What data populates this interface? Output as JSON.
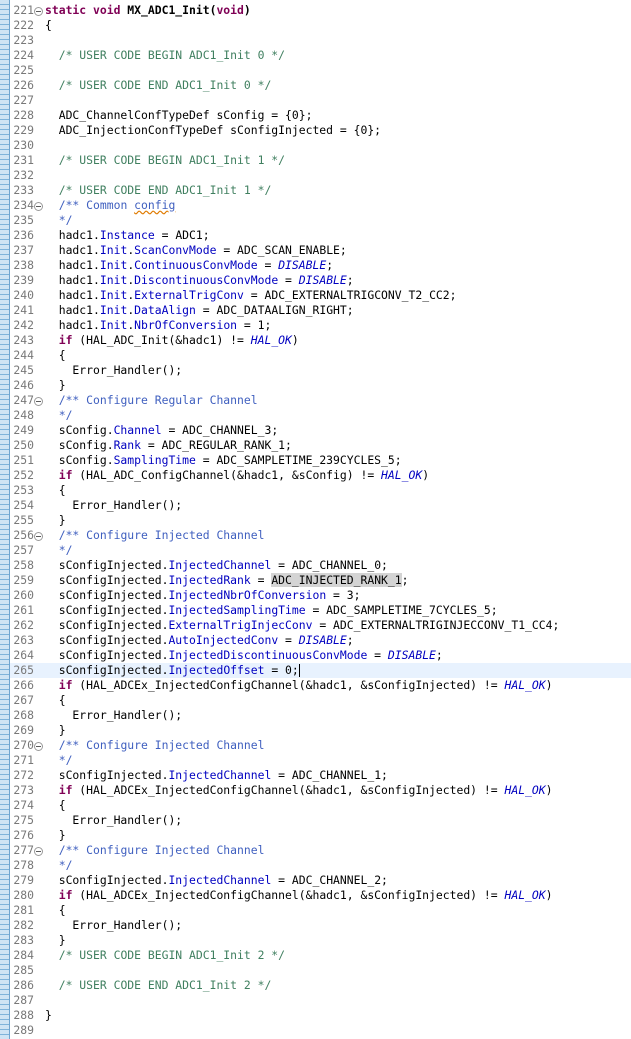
{
  "editor": {
    "language": "C",
    "current_line": "265",
    "lines": [
      {
        "n": "221",
        "fold": true,
        "t": [
          [
            "static void ",
            "kw"
          ],
          [
            "MX_ADC1_Init",
            "b"
          ],
          [
            "(",
            "b"
          ],
          [
            "void",
            "kw"
          ],
          [
            ")",
            "b"
          ]
        ]
      },
      {
        "n": "222",
        "t": [
          [
            "{",
            ""
          ]
        ]
      },
      {
        "n": "223",
        "t": []
      },
      {
        "n": "224",
        "t": [
          [
            "  ",
            ""
          ],
          [
            "/* USER CODE BEGIN ADC1_Init 0 */",
            "cm"
          ]
        ]
      },
      {
        "n": "225",
        "t": []
      },
      {
        "n": "226",
        "t": [
          [
            "  ",
            ""
          ],
          [
            "/* USER CODE END ADC1_Init 0 */",
            "cm"
          ]
        ]
      },
      {
        "n": "227",
        "t": []
      },
      {
        "n": "228",
        "t": [
          [
            "  ADC_ChannelConfTypeDef sConfig = {0};",
            ""
          ]
        ]
      },
      {
        "n": "229",
        "t": [
          [
            "  ADC_InjectionConfTypeDef sConfigInjected = {0};",
            ""
          ]
        ]
      },
      {
        "n": "230",
        "t": []
      },
      {
        "n": "231",
        "t": [
          [
            "  ",
            ""
          ],
          [
            "/* USER CODE BEGIN ADC1_Init 1 */",
            "cm"
          ]
        ]
      },
      {
        "n": "232",
        "t": []
      },
      {
        "n": "233",
        "t": [
          [
            "  ",
            ""
          ],
          [
            "/* USER CODE END ADC1_Init 1 */",
            "cm"
          ]
        ]
      },
      {
        "n": "234",
        "fold": true,
        "t": [
          [
            "  ",
            ""
          ],
          [
            "/** Common ",
            "jd"
          ],
          [
            "config",
            "jd sq"
          ]
        ]
      },
      {
        "n": "235",
        "t": [
          [
            "  ",
            ""
          ],
          [
            "*/",
            "jd"
          ]
        ]
      },
      {
        "n": "236",
        "t": [
          [
            "  hadc1.",
            ""
          ],
          [
            "Instance",
            "fld"
          ],
          [
            " = ADC1;",
            ""
          ]
        ]
      },
      {
        "n": "237",
        "t": [
          [
            "  hadc1.",
            ""
          ],
          [
            "Init",
            "fld"
          ],
          [
            ".",
            ""
          ],
          [
            "ScanConvMode",
            "fld"
          ],
          [
            " = ADC_SCAN_ENABLE;",
            ""
          ]
        ]
      },
      {
        "n": "238",
        "t": [
          [
            "  hadc1.",
            ""
          ],
          [
            "Init",
            "fld"
          ],
          [
            ".",
            ""
          ],
          [
            "ContinuousConvMode",
            "fld"
          ],
          [
            " = ",
            ""
          ],
          [
            "DISABLE",
            "mac"
          ],
          [
            ";",
            ""
          ]
        ]
      },
      {
        "n": "239",
        "t": [
          [
            "  hadc1.",
            ""
          ],
          [
            "Init",
            "fld"
          ],
          [
            ".",
            ""
          ],
          [
            "DiscontinuousConvMode",
            "fld"
          ],
          [
            " = ",
            ""
          ],
          [
            "DISABLE",
            "mac"
          ],
          [
            ";",
            ""
          ]
        ]
      },
      {
        "n": "240",
        "t": [
          [
            "  hadc1.",
            ""
          ],
          [
            "Init",
            "fld"
          ],
          [
            ".",
            ""
          ],
          [
            "ExternalTrigConv",
            "fld"
          ],
          [
            " = ADC_EXTERNALTRIGCONV_T2_CC2;",
            ""
          ]
        ]
      },
      {
        "n": "241",
        "t": [
          [
            "  hadc1.",
            ""
          ],
          [
            "Init",
            "fld"
          ],
          [
            ".",
            ""
          ],
          [
            "DataAlign",
            "fld"
          ],
          [
            " = ADC_DATAALIGN_RIGHT;",
            ""
          ]
        ]
      },
      {
        "n": "242",
        "t": [
          [
            "  hadc1.",
            ""
          ],
          [
            "Init",
            "fld"
          ],
          [
            ".",
            ""
          ],
          [
            "NbrOfConversion",
            "fld"
          ],
          [
            " = 1;",
            ""
          ]
        ]
      },
      {
        "n": "243",
        "t": [
          [
            "  ",
            ""
          ],
          [
            "if",
            "kw"
          ],
          [
            " (HAL_ADC_Init(&hadc1) != ",
            ""
          ],
          [
            "HAL_OK",
            "mac"
          ],
          [
            ")",
            ""
          ]
        ]
      },
      {
        "n": "244",
        "t": [
          [
            "  {",
            ""
          ]
        ]
      },
      {
        "n": "245",
        "t": [
          [
            "    Error_Handler();",
            ""
          ]
        ]
      },
      {
        "n": "246",
        "t": [
          [
            "  }",
            ""
          ]
        ]
      },
      {
        "n": "247",
        "fold": true,
        "t": [
          [
            "  ",
            ""
          ],
          [
            "/** Configure Regular Channel",
            "jd"
          ]
        ]
      },
      {
        "n": "248",
        "t": [
          [
            "  ",
            ""
          ],
          [
            "*/",
            "jd"
          ]
        ]
      },
      {
        "n": "249",
        "t": [
          [
            "  sConfig.",
            ""
          ],
          [
            "Channel",
            "fld"
          ],
          [
            " = ADC_CHANNEL_3;",
            ""
          ]
        ]
      },
      {
        "n": "250",
        "t": [
          [
            "  sConfig.",
            ""
          ],
          [
            "Rank",
            "fld"
          ],
          [
            " = ADC_REGULAR_RANK_1;",
            ""
          ]
        ]
      },
      {
        "n": "251",
        "t": [
          [
            "  sConfig.",
            ""
          ],
          [
            "SamplingTime",
            "fld"
          ],
          [
            " = ADC_SAMPLETIME_239CYCLES_5;",
            ""
          ]
        ]
      },
      {
        "n": "252",
        "t": [
          [
            "  ",
            ""
          ],
          [
            "if",
            "kw"
          ],
          [
            " (HAL_ADC_ConfigChannel(&hadc1, &sConfig) != ",
            ""
          ],
          [
            "HAL_OK",
            "mac"
          ],
          [
            ")",
            ""
          ]
        ]
      },
      {
        "n": "253",
        "t": [
          [
            "  {",
            ""
          ]
        ]
      },
      {
        "n": "254",
        "t": [
          [
            "    Error_Handler();",
            ""
          ]
        ]
      },
      {
        "n": "255",
        "t": [
          [
            "  }",
            ""
          ]
        ]
      },
      {
        "n": "256",
        "fold": true,
        "t": [
          [
            "  ",
            ""
          ],
          [
            "/** Configure Injected Channel",
            "jd"
          ]
        ]
      },
      {
        "n": "257",
        "t": [
          [
            "  ",
            ""
          ],
          [
            "*/",
            "jd"
          ]
        ]
      },
      {
        "n": "258",
        "t": [
          [
            "  sConfigInjected.",
            ""
          ],
          [
            "InjectedChannel",
            "fld"
          ],
          [
            " = ADC_CHANNEL_0;",
            ""
          ]
        ]
      },
      {
        "n": "259",
        "t": [
          [
            "  sConfigInjected.",
            ""
          ],
          [
            "InjectedRank",
            "fld"
          ],
          [
            " = ",
            ""
          ],
          [
            "ADC_INJECTED_RANK_1",
            "hl"
          ],
          [
            ";",
            ""
          ]
        ]
      },
      {
        "n": "260",
        "t": [
          [
            "  sConfigInjected.",
            ""
          ],
          [
            "InjectedNbrOfConversion",
            "fld"
          ],
          [
            " = 3;",
            ""
          ]
        ]
      },
      {
        "n": "261",
        "t": [
          [
            "  sConfigInjected.",
            ""
          ],
          [
            "InjectedSamplingTime",
            "fld"
          ],
          [
            " = ADC_SAMPLETIME_7CYCLES_5;",
            ""
          ]
        ]
      },
      {
        "n": "262",
        "t": [
          [
            "  sConfigInjected.",
            ""
          ],
          [
            "ExternalTrigInjecConv",
            "fld"
          ],
          [
            " = ADC_EXTERNALTRIGINJECCONV_T1_CC4;",
            ""
          ]
        ]
      },
      {
        "n": "263",
        "t": [
          [
            "  sConfigInjected.",
            ""
          ],
          [
            "AutoInjectedConv",
            "fld"
          ],
          [
            " = ",
            ""
          ],
          [
            "DISABLE",
            "mac"
          ],
          [
            ";",
            ""
          ]
        ]
      },
      {
        "n": "264",
        "t": [
          [
            "  sConfigInjected.",
            ""
          ],
          [
            "InjectedDiscontinuousConvMode",
            "fld"
          ],
          [
            " = ",
            ""
          ],
          [
            "DISABLE",
            "mac"
          ],
          [
            ";",
            ""
          ]
        ]
      },
      {
        "n": "265",
        "caret": true,
        "t": [
          [
            "  sConfigInjected.",
            ""
          ],
          [
            "InjectedOffset",
            "fld"
          ],
          [
            " = 0;",
            ""
          ]
        ]
      },
      {
        "n": "266",
        "t": [
          [
            "  ",
            ""
          ],
          [
            "if",
            "kw"
          ],
          [
            " (HAL_ADCEx_InjectedConfigChannel(&hadc1, &sConfigInjected) != ",
            ""
          ],
          [
            "HAL_OK",
            "mac"
          ],
          [
            ")",
            ""
          ]
        ]
      },
      {
        "n": "267",
        "t": [
          [
            "  {",
            ""
          ]
        ]
      },
      {
        "n": "268",
        "t": [
          [
            "    Error_Handler();",
            ""
          ]
        ]
      },
      {
        "n": "269",
        "t": [
          [
            "  }",
            ""
          ]
        ]
      },
      {
        "n": "270",
        "fold": true,
        "t": [
          [
            "  ",
            ""
          ],
          [
            "/** Configure Injected Channel",
            "jd"
          ]
        ]
      },
      {
        "n": "271",
        "t": [
          [
            "  ",
            ""
          ],
          [
            "*/",
            "jd"
          ]
        ]
      },
      {
        "n": "272",
        "t": [
          [
            "  sConfigInjected.",
            ""
          ],
          [
            "InjectedChannel",
            "fld"
          ],
          [
            " = ADC_CHANNEL_1;",
            ""
          ]
        ]
      },
      {
        "n": "273",
        "t": [
          [
            "  ",
            ""
          ],
          [
            "if",
            "kw"
          ],
          [
            " (HAL_ADCEx_InjectedConfigChannel(&hadc1, &sConfigInjected) != ",
            ""
          ],
          [
            "HAL_OK",
            "mac"
          ],
          [
            ")",
            ""
          ]
        ]
      },
      {
        "n": "274",
        "t": [
          [
            "  {",
            ""
          ]
        ]
      },
      {
        "n": "275",
        "t": [
          [
            "    Error_Handler();",
            ""
          ]
        ]
      },
      {
        "n": "276",
        "t": [
          [
            "  }",
            ""
          ]
        ]
      },
      {
        "n": "277",
        "fold": true,
        "t": [
          [
            "  ",
            ""
          ],
          [
            "/** Configure Injected Channel",
            "jd"
          ]
        ]
      },
      {
        "n": "278",
        "t": [
          [
            "  ",
            ""
          ],
          [
            "*/",
            "jd"
          ]
        ]
      },
      {
        "n": "279",
        "t": [
          [
            "  sConfigInjected.",
            ""
          ],
          [
            "InjectedChannel",
            "fld"
          ],
          [
            " = ADC_CHANNEL_2;",
            ""
          ]
        ]
      },
      {
        "n": "280",
        "t": [
          [
            "  ",
            ""
          ],
          [
            "if",
            "kw"
          ],
          [
            " (HAL_ADCEx_InjectedConfigChannel(&hadc1, &sConfigInjected) != ",
            ""
          ],
          [
            "HAL_OK",
            "mac"
          ],
          [
            ")",
            ""
          ]
        ]
      },
      {
        "n": "281",
        "t": [
          [
            "  {",
            ""
          ]
        ]
      },
      {
        "n": "282",
        "t": [
          [
            "    Error_Handler();",
            ""
          ]
        ]
      },
      {
        "n": "283",
        "t": [
          [
            "  }",
            ""
          ]
        ]
      },
      {
        "n": "284",
        "t": [
          [
            "  ",
            ""
          ],
          [
            "/* USER CODE BEGIN ADC1_Init 2 */",
            "cm"
          ]
        ]
      },
      {
        "n": "285",
        "t": []
      },
      {
        "n": "286",
        "t": [
          [
            "  ",
            ""
          ],
          [
            "/* USER CODE END ADC1_Init 2 */",
            "cm"
          ]
        ]
      },
      {
        "n": "287",
        "t": []
      },
      {
        "n": "288",
        "t": [
          [
            "}",
            ""
          ]
        ]
      },
      {
        "n": "289",
        "t": []
      }
    ]
  }
}
